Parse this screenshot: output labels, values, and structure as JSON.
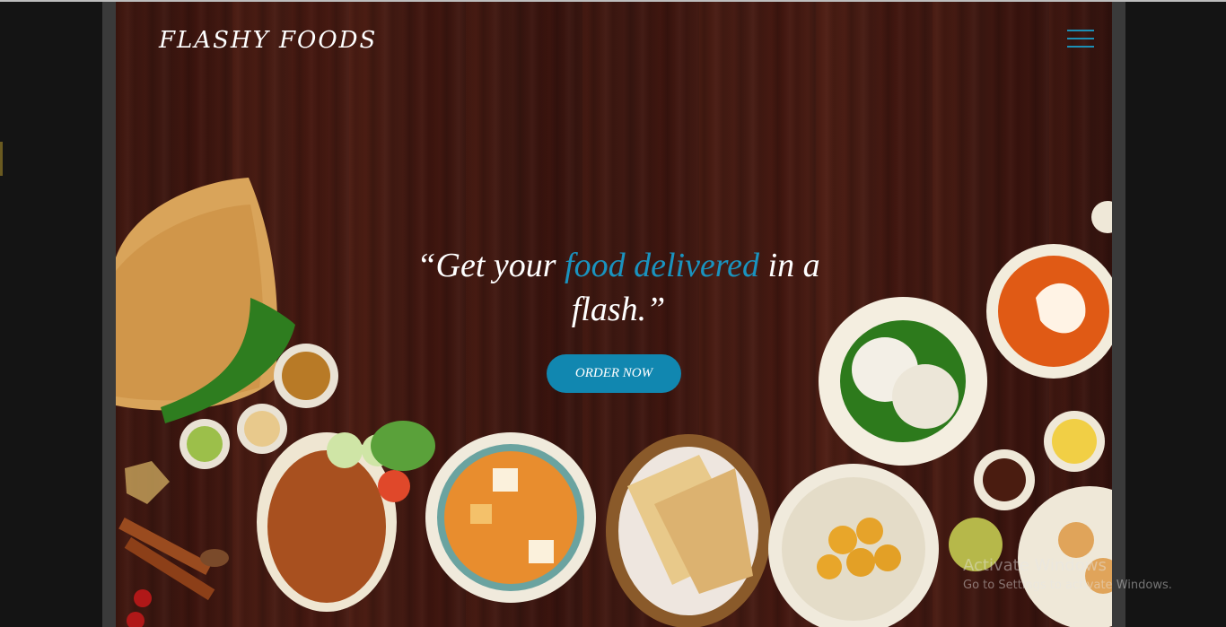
{
  "site": {
    "brand": "FLASHY FOODS",
    "menu_icon": "hamburger-menu-icon"
  },
  "hero": {
    "quote_open": "“Get your ",
    "quote_accent": "food delivered",
    "quote_close": " in a flash.”",
    "button_label": "ORDER NOW"
  },
  "colors": {
    "accent": "#1a93bf",
    "button": "#1187b0",
    "background": "#3e1812"
  },
  "watermark": {
    "line1": "Activate Windows",
    "line2": "Go to Settings to activate Windows."
  }
}
